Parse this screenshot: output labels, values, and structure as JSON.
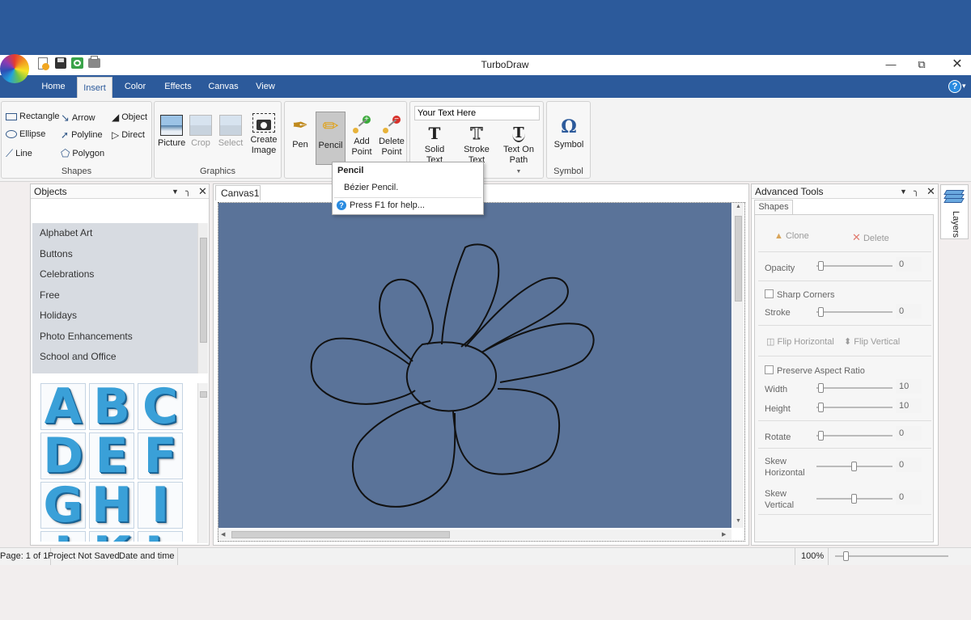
{
  "app": {
    "title": "TurboDraw"
  },
  "ribbon_tabs": [
    "Home",
    "Insert",
    "Color",
    "Effects",
    "Canvas",
    "View"
  ],
  "groups": {
    "shapes": {
      "name": "Shapes",
      "items": [
        "Rectangle",
        "Arrow",
        "Object",
        "Ellipse",
        "Polyline",
        "Direct",
        "Line",
        "Polygon"
      ]
    },
    "graphics": {
      "name": "Graphics",
      "picture": "Picture",
      "crop": "Crop",
      "select": "Select",
      "create_image_1": "Create",
      "create_image_2": "Image"
    },
    "pen": {
      "pen": "Pen",
      "pencil": "Pencil",
      "add_1": "Add",
      "add_2": "Point",
      "del_1": "Delete",
      "del_2": "Point"
    },
    "text": {
      "input_value": "Your Text Here",
      "solid_1": "Solid",
      "solid_2": "Text",
      "stroke_1": "Stroke",
      "stroke_2": "Text",
      "path_1": "Text On",
      "path_2": "Path"
    },
    "symbol": {
      "button": "Symbol",
      "name": "Symbol",
      "glyph": "Ω"
    }
  },
  "tooltip": {
    "title": "Pencil",
    "description": "Bézier Pencil.",
    "help": "Press F1 for help..."
  },
  "objects_pane": {
    "title": "Objects",
    "categories": [
      "Alphabet Art",
      "Buttons",
      "Celebrations",
      "Free",
      "Holidays",
      "Photo Enhancements",
      "School and Office"
    ],
    "letters": [
      "A",
      "B",
      "C",
      "D",
      "E",
      "F",
      "G",
      "H",
      "I",
      "J",
      "K",
      "L"
    ]
  },
  "canvas": {
    "tab": "Canvas1",
    "background": "#5a7399"
  },
  "advanced": {
    "title": "Advanced Tools",
    "tab": "Shapes",
    "clone": "Clone",
    "delete": "Delete",
    "opacity": "Opacity",
    "opacity_value": "0",
    "sharp_corners": "Sharp Corners",
    "stroke": "Stroke",
    "stroke_value": "0",
    "flip_h": "Flip Horizontal",
    "flip_v": "Flip Vertical",
    "preserve": "Preserve Aspect Ratio",
    "width": "Width",
    "width_value": "10",
    "height": "Height",
    "height_value": "10",
    "rotate": "Rotate",
    "rotate_value": "0",
    "skew_h_1": "Skew",
    "skew_h_2": "Horizontal",
    "skew_h_value": "0",
    "skew_v_1": "Skew",
    "skew_v_2": "Vertical",
    "skew_v_value": "0"
  },
  "layers_tab": "Layers",
  "status": {
    "page": "Page: 1 of 1",
    "project": "Project Not Saved",
    "datetime": "Date and time",
    "zoom": "100%"
  },
  "colors": {
    "brand": "#2c5a9b"
  }
}
